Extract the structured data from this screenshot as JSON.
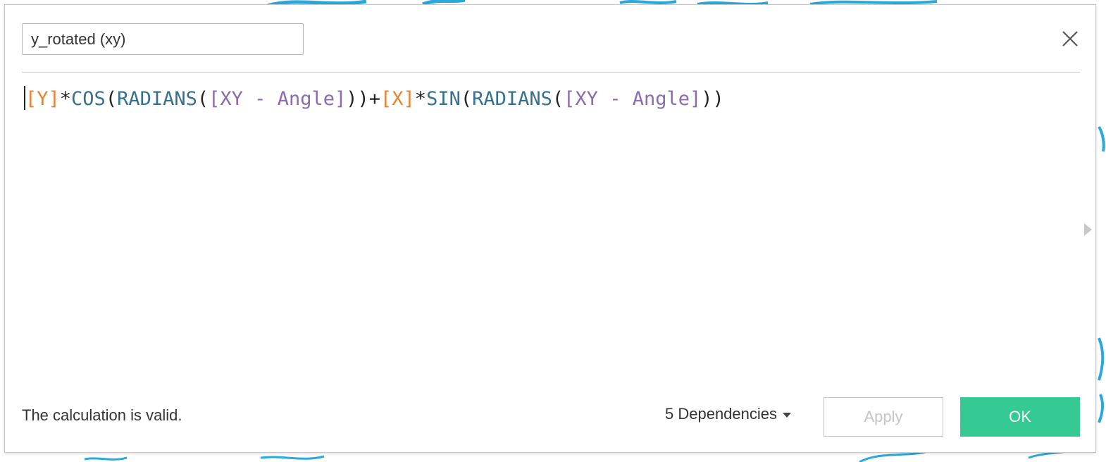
{
  "calc_name": "y_rotated (xy)",
  "formula": {
    "tokens": [
      {
        "type": "field",
        "text": "[Y]"
      },
      {
        "type": "op",
        "text": "*"
      },
      {
        "type": "func",
        "text": "COS"
      },
      {
        "type": "op",
        "text": "("
      },
      {
        "type": "func",
        "text": "RADIANS"
      },
      {
        "type": "op",
        "text": "("
      },
      {
        "type": "param",
        "text": "[XY - Angle]"
      },
      {
        "type": "op",
        "text": "))+"
      },
      {
        "type": "field",
        "text": "[X]"
      },
      {
        "type": "op",
        "text": "*"
      },
      {
        "type": "func",
        "text": "SIN"
      },
      {
        "type": "op",
        "text": "("
      },
      {
        "type": "func",
        "text": "RADIANS"
      },
      {
        "type": "op",
        "text": "("
      },
      {
        "type": "param",
        "text": "[XY - Angle]"
      },
      {
        "type": "op",
        "text": "))"
      }
    ]
  },
  "status": "The calculation is valid.",
  "dependencies_label": "5 Dependencies",
  "apply_label": "Apply",
  "ok_label": "OK",
  "icons": {
    "close": "close-icon",
    "dependencies_caret": "caret-down-icon",
    "panel_expand": "triangle-right-icon"
  },
  "colors": {
    "field": "#e8822f",
    "function": "#35718f",
    "parameter": "#8a6bb0",
    "ok_button": "#35c994",
    "backdrop_accent": "#29a9dc"
  }
}
